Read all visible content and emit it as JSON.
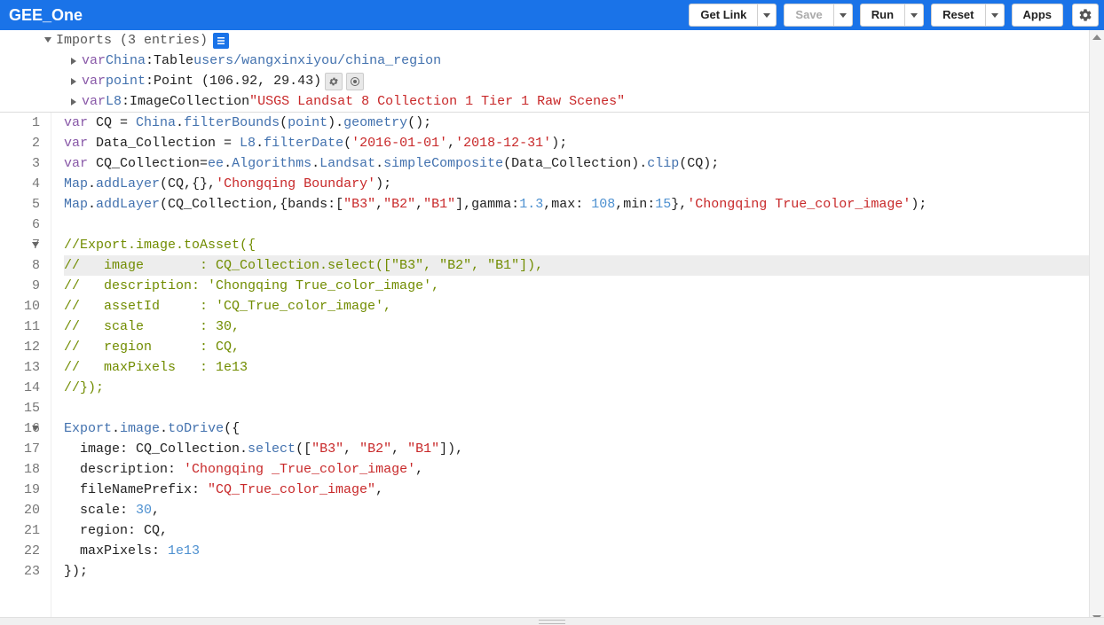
{
  "header": {
    "title": "GEE_One",
    "get_link": "Get Link",
    "save": "Save",
    "run": "Run",
    "reset": "Reset",
    "apps": "Apps"
  },
  "imports": {
    "header_text": "Imports (3 entries)",
    "rows": [
      {
        "var": "var",
        "name": "China",
        "sep": ": ",
        "type": "Table ",
        "value": "users/wangxinxiyou/china_region"
      },
      {
        "var": "var",
        "name": "point",
        "sep": ": ",
        "type": "Point (106.92, 29.43)",
        "value": ""
      },
      {
        "var": "var",
        "name": "L8",
        "sep": ": ",
        "type": "ImageCollection ",
        "value": "\"USGS Landsat 8 Collection 1 Tier 1 Raw Scenes\""
      }
    ]
  },
  "code": {
    "highlighted_line": 8,
    "fold_lines": [
      7,
      16
    ],
    "lines": [
      {
        "n": 1,
        "tokens": [
          {
            "c": "kw",
            "t": "var"
          },
          {
            "c": "plain",
            "t": " CQ = "
          },
          {
            "c": "prop",
            "t": "China"
          },
          {
            "c": "plain",
            "t": "."
          },
          {
            "c": "def",
            "t": "filterBounds"
          },
          {
            "c": "plain",
            "t": "("
          },
          {
            "c": "prop",
            "t": "point"
          },
          {
            "c": "plain",
            "t": ")."
          },
          {
            "c": "def",
            "t": "geometry"
          },
          {
            "c": "plain",
            "t": "();"
          }
        ]
      },
      {
        "n": 2,
        "tokens": [
          {
            "c": "kw",
            "t": "var"
          },
          {
            "c": "plain",
            "t": " Data_Collection = "
          },
          {
            "c": "prop",
            "t": "L8"
          },
          {
            "c": "plain",
            "t": "."
          },
          {
            "c": "def",
            "t": "filterDate"
          },
          {
            "c": "plain",
            "t": "("
          },
          {
            "c": "str",
            "t": "'2016-01-01'"
          },
          {
            "c": "plain",
            "t": ","
          },
          {
            "c": "str",
            "t": "'2018-12-31'"
          },
          {
            "c": "plain",
            "t": ");"
          }
        ]
      },
      {
        "n": 3,
        "tokens": [
          {
            "c": "kw",
            "t": "var"
          },
          {
            "c": "plain",
            "t": " CQ_Collection="
          },
          {
            "c": "prop",
            "t": "ee"
          },
          {
            "c": "plain",
            "t": "."
          },
          {
            "c": "prop",
            "t": "Algorithms"
          },
          {
            "c": "plain",
            "t": "."
          },
          {
            "c": "prop",
            "t": "Landsat"
          },
          {
            "c": "plain",
            "t": "."
          },
          {
            "c": "def",
            "t": "simpleComposite"
          },
          {
            "c": "plain",
            "t": "(Data_Collection)."
          },
          {
            "c": "def",
            "t": "clip"
          },
          {
            "c": "plain",
            "t": "(CQ);"
          }
        ]
      },
      {
        "n": 4,
        "tokens": [
          {
            "c": "prop",
            "t": "Map"
          },
          {
            "c": "plain",
            "t": "."
          },
          {
            "c": "def",
            "t": "addLayer"
          },
          {
            "c": "plain",
            "t": "(CQ,{},"
          },
          {
            "c": "str",
            "t": "'Chongqing Boundary'"
          },
          {
            "c": "plain",
            "t": ");"
          }
        ]
      },
      {
        "n": 5,
        "tokens": [
          {
            "c": "prop",
            "t": "Map"
          },
          {
            "c": "plain",
            "t": "."
          },
          {
            "c": "def",
            "t": "addLayer"
          },
          {
            "c": "plain",
            "t": "(CQ_Collection,{bands:["
          },
          {
            "c": "str",
            "t": "\"B3\""
          },
          {
            "c": "plain",
            "t": ","
          },
          {
            "c": "str",
            "t": "\"B2\""
          },
          {
            "c": "plain",
            "t": ","
          },
          {
            "c": "str",
            "t": "\"B1\""
          },
          {
            "c": "plain",
            "t": "],gamma:"
          },
          {
            "c": "num",
            "t": "1.3"
          },
          {
            "c": "plain",
            "t": ",max: "
          },
          {
            "c": "num",
            "t": "108"
          },
          {
            "c": "plain",
            "t": ",min:"
          },
          {
            "c": "num",
            "t": "15"
          },
          {
            "c": "plain",
            "t": "},"
          },
          {
            "c": "str",
            "t": "'Chongqing True_color_image'"
          },
          {
            "c": "plain",
            "t": ");"
          }
        ]
      },
      {
        "n": 6,
        "tokens": [
          {
            "c": "plain",
            "t": ""
          }
        ]
      },
      {
        "n": 7,
        "tokens": [
          {
            "c": "cmt",
            "t": "//Export.image.toAsset({"
          }
        ]
      },
      {
        "n": 8,
        "tokens": [
          {
            "c": "cmt",
            "t": "//   image       : CQ_Collection.select([\"B3\", \"B2\", \"B1\"]),"
          }
        ]
      },
      {
        "n": 9,
        "tokens": [
          {
            "c": "cmt",
            "t": "//   description: 'Chongqing True_color_image',"
          }
        ]
      },
      {
        "n": 10,
        "tokens": [
          {
            "c": "cmt",
            "t": "//   assetId     : 'CQ_True_color_image',"
          }
        ]
      },
      {
        "n": 11,
        "tokens": [
          {
            "c": "cmt",
            "t": "//   scale       : 30,"
          }
        ]
      },
      {
        "n": 12,
        "tokens": [
          {
            "c": "cmt",
            "t": "//   region      : CQ,"
          }
        ]
      },
      {
        "n": 13,
        "tokens": [
          {
            "c": "cmt",
            "t": "//   maxPixels   : 1e13"
          }
        ]
      },
      {
        "n": 14,
        "tokens": [
          {
            "c": "cmt",
            "t": "//});"
          }
        ]
      },
      {
        "n": 15,
        "tokens": [
          {
            "c": "plain",
            "t": ""
          }
        ]
      },
      {
        "n": 16,
        "tokens": [
          {
            "c": "prop",
            "t": "Export"
          },
          {
            "c": "plain",
            "t": "."
          },
          {
            "c": "prop",
            "t": "image"
          },
          {
            "c": "plain",
            "t": "."
          },
          {
            "c": "def",
            "t": "toDrive"
          },
          {
            "c": "plain",
            "t": "({"
          }
        ]
      },
      {
        "n": 17,
        "tokens": [
          {
            "c": "plain",
            "t": "  image: CQ_Collection."
          },
          {
            "c": "def",
            "t": "select"
          },
          {
            "c": "plain",
            "t": "(["
          },
          {
            "c": "str",
            "t": "\"B3\""
          },
          {
            "c": "plain",
            "t": ", "
          },
          {
            "c": "str",
            "t": "\"B2\""
          },
          {
            "c": "plain",
            "t": ", "
          },
          {
            "c": "str",
            "t": "\"B1\""
          },
          {
            "c": "plain",
            "t": "]),"
          }
        ]
      },
      {
        "n": 18,
        "tokens": [
          {
            "c": "plain",
            "t": "  description: "
          },
          {
            "c": "str",
            "t": "'Chongqing _True_color_image'"
          },
          {
            "c": "plain",
            "t": ","
          }
        ]
      },
      {
        "n": 19,
        "tokens": [
          {
            "c": "plain",
            "t": "  fileNamePrefix: "
          },
          {
            "c": "str",
            "t": "\"CQ_True_color_image\""
          },
          {
            "c": "plain",
            "t": ","
          }
        ]
      },
      {
        "n": 20,
        "tokens": [
          {
            "c": "plain",
            "t": "  scale: "
          },
          {
            "c": "num",
            "t": "30"
          },
          {
            "c": "plain",
            "t": ","
          }
        ]
      },
      {
        "n": 21,
        "tokens": [
          {
            "c": "plain",
            "t": "  region: CQ,"
          }
        ]
      },
      {
        "n": 22,
        "tokens": [
          {
            "c": "plain",
            "t": "  maxPixels: "
          },
          {
            "c": "num",
            "t": "1e13"
          }
        ]
      },
      {
        "n": 23,
        "tokens": [
          {
            "c": "plain",
            "t": "});"
          }
        ]
      }
    ]
  }
}
